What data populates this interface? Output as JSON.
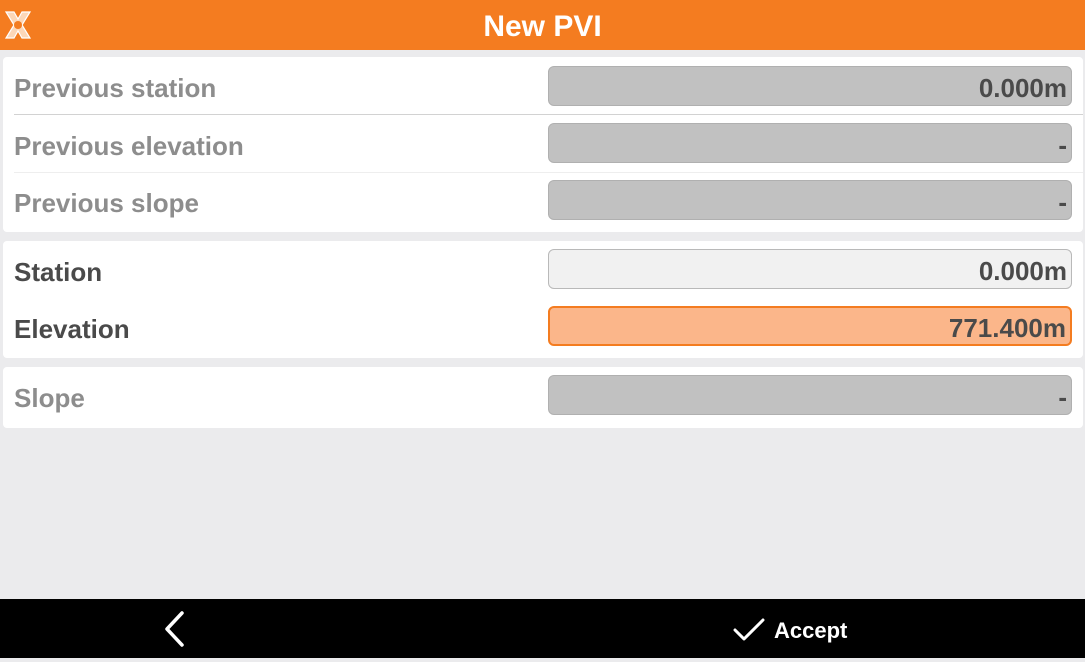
{
  "header": {
    "title": "New PVI",
    "logo_icon": "app-logo-icon",
    "color": "#f47c20"
  },
  "previous": {
    "station": {
      "label": "Previous station",
      "value": "0.000m"
    },
    "elevation": {
      "label": "Previous elevation",
      "value": "-"
    },
    "slope": {
      "label": "Previous slope",
      "value": "-"
    }
  },
  "current": {
    "station": {
      "label": "Station",
      "value": "0.000m"
    },
    "elevation": {
      "label": "Elevation",
      "value": "771.400m"
    }
  },
  "slope": {
    "label": "Slope",
    "value": "-"
  },
  "footer": {
    "back_icon": "chevron-left-icon",
    "accept_icon": "checkmark-icon",
    "accept_label": "Accept"
  },
  "colors": {
    "accent": "#f47c20",
    "active_field": "#fbb68a",
    "disabled_field": "#c1c1c1",
    "background": "#ebebed",
    "footer": "#000000"
  }
}
